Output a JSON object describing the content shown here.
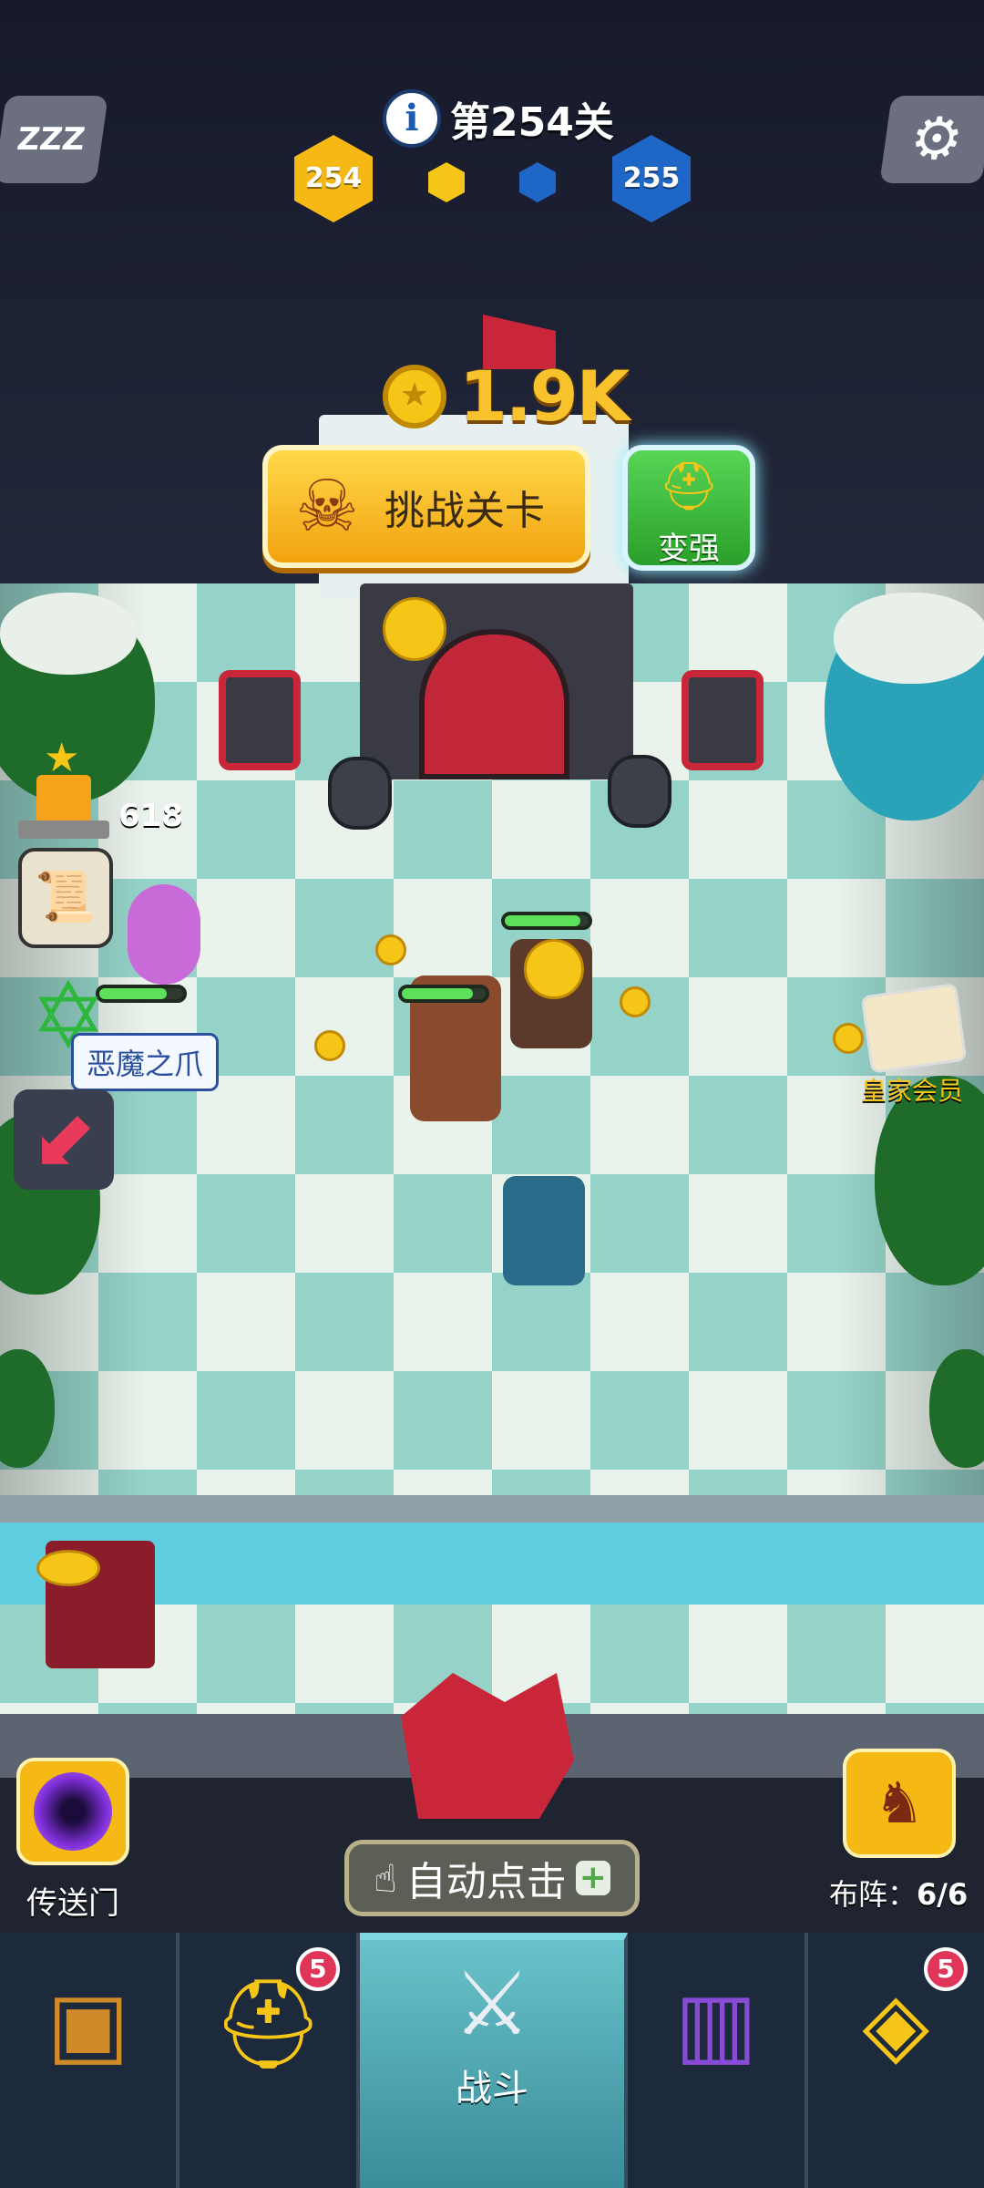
{
  "hud": {
    "level_text": "第254关",
    "current_level": "254",
    "next_level": "255",
    "sleep_label": "ZZZ"
  },
  "reward": {
    "amount": "1.9K"
  },
  "buttons": {
    "challenge": "挑战关卡",
    "upgrade": "变强",
    "auto_click": "自动点击",
    "portal": "传送门",
    "formation_label": "布阵：",
    "formation_count": "6/6"
  },
  "sidebar": {
    "trophy_count": "618",
    "demon_claw": "恶魔之爪",
    "royal_member": "皇家会员"
  },
  "tabs": {
    "battle_label": "战斗",
    "hero_badge": "5",
    "amulet_badge": "5"
  },
  "icons": [
    "info-icon",
    "zzz-icon",
    "gear-icon",
    "gold-coin-icon",
    "skull-icon",
    "helmet-icon",
    "trophy-icon",
    "scroll-icon",
    "star-icon",
    "arrow-icon",
    "portal-icon",
    "tap-icon",
    "plus-icon",
    "formation-icon",
    "chest-icon",
    "crossed-swords-icon",
    "spellbook-icon",
    "amulet-icon"
  ],
  "colors": {
    "gold": "#f5c518",
    "hex_yellow": "#f5b815",
    "hex_blue": "#1f67c7",
    "green": "#2db83d",
    "badge": "#e03558",
    "tab_active": "#69c2cb"
  }
}
